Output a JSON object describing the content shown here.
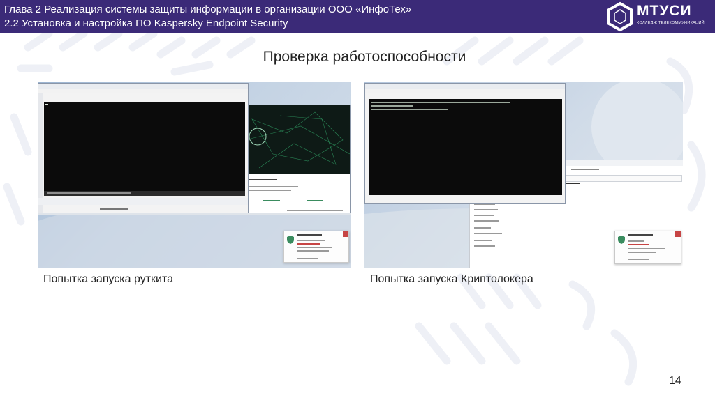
{
  "header": {
    "line1": "Глава 2 Реализация системы защиты информации в организации ООО «ИнфоТех»",
    "line2": "2.2 Установка и настройка ПО Kaspersky Endpoint Security"
  },
  "logo": {
    "name": "МТУСИ",
    "subtitle": "КОЛЛЕДЖ ТЕЛЕКОММУНИКАЦИЙ"
  },
  "slide": {
    "title": "Проверка работоспособности",
    "page_number": "14"
  },
  "screenshots": [
    {
      "caption": "Попытка запуска руткита"
    },
    {
      "caption": "Попытка запуска Криптолокера"
    }
  ],
  "colors": {
    "header_bg": "#3b2a78",
    "pattern": "#eef0f6"
  }
}
